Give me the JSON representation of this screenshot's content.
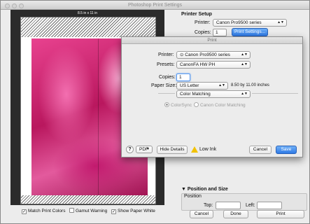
{
  "window": {
    "title": "Photoshop Print Settings"
  },
  "preview": {
    "paper_size_label": "8.5 in x 11 in"
  },
  "printer_setup": {
    "heading": "Printer Setup",
    "printer_label": "Printer:",
    "printer_value": "Canon Pro9500 series",
    "copies_label": "Copies:",
    "copies_value": "1",
    "print_settings_label": "Print Settings..."
  },
  "print_dialog": {
    "title": "Print",
    "printer_label": "Printer:",
    "printer_value": "⊙ Canon Pro9500 series",
    "presets_label": "Presets:",
    "presets_value": "CanonFA HW PH",
    "copies_label": "Copies:",
    "copies_value": "1",
    "paper_size_label": "Paper Size:",
    "paper_size_value": "US Letter",
    "paper_size_dims": "8.50 by 11.00 inches",
    "panel_value": "Color Matching",
    "colorsync_label": "ColorSync",
    "canon_matching_label": "Canon Color Matching",
    "help_label": "?",
    "pdf_label": "PDF",
    "hide_details_label": "Hide Details",
    "low_ink_label": "Low Ink",
    "cancel_label": "Cancel",
    "save_label": "Save"
  },
  "position_size": {
    "heading": "Position and Size",
    "position_label": "Position",
    "top_label": "Top:",
    "left_label": "Left:"
  },
  "footer": {
    "match_colors_label": "Match Print Colors",
    "gamut_warning_label": "Gamut Warning",
    "show_paper_white_label": "Show Paper White",
    "cancel_label": "Cancel",
    "done_label": "Done",
    "print_label": "Print"
  }
}
